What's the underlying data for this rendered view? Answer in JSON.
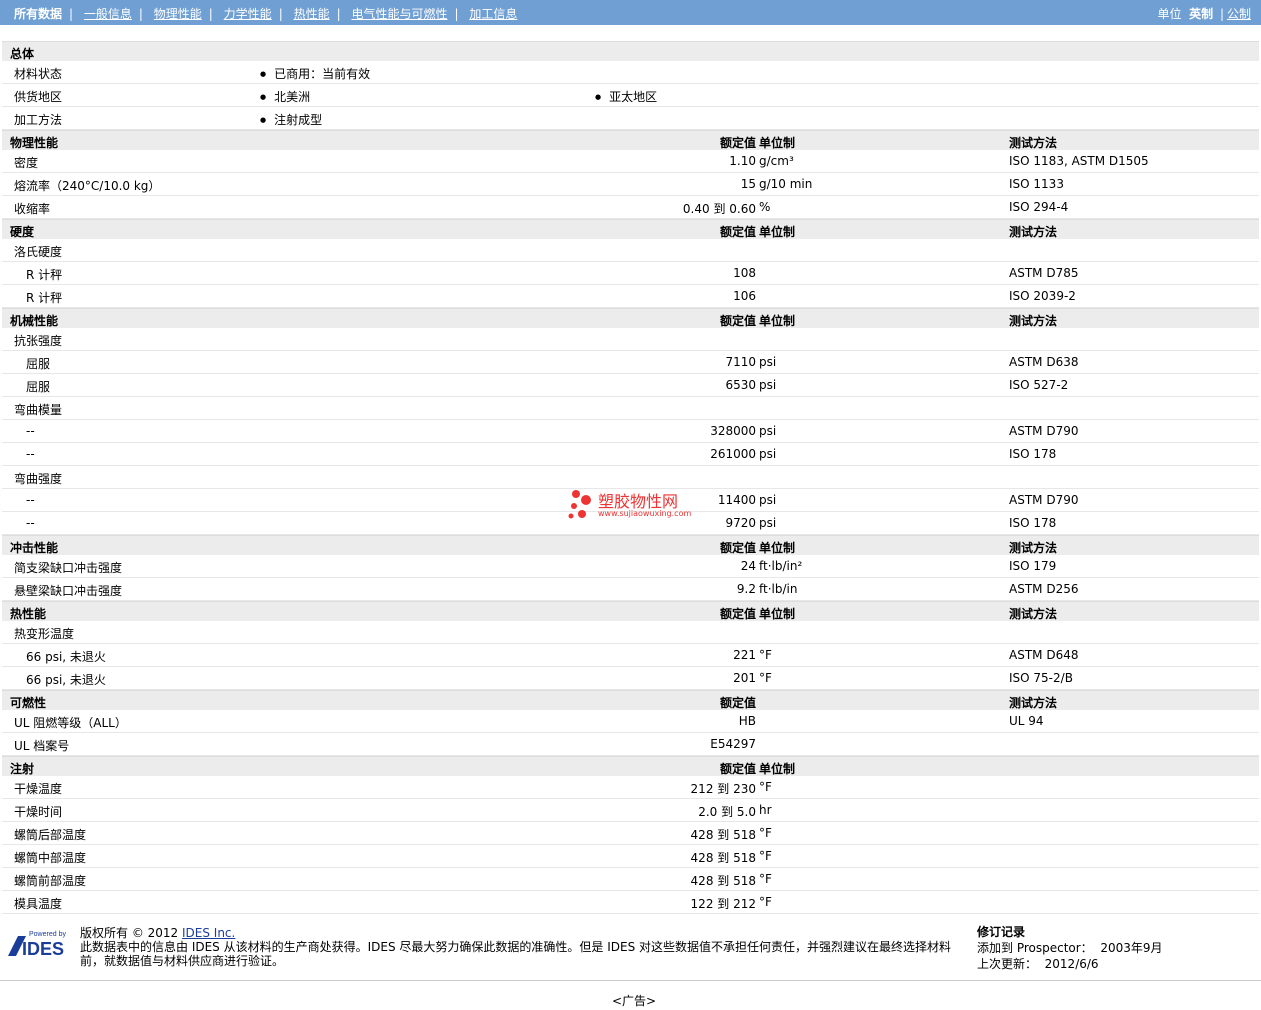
{
  "nav": {
    "items": [
      "所有数据",
      "一般信息",
      "物理性能",
      "力学性能",
      "热性能",
      "电气性能与可燃性",
      "加工信息"
    ],
    "units_label": "单位",
    "unit_selected": "英制",
    "unit_other": "公制"
  },
  "colors": {
    "topbar": "#6f9fd3",
    "section_bg": "#ececec",
    "watermark": "#e33333"
  },
  "general": {
    "title": "总体",
    "material_status": {
      "label": "材料状态",
      "values": [
        "已商用：当前有效"
      ]
    },
    "supply_region": {
      "label": "供货地区",
      "values": [
        "北美洲",
        "亚太地区"
      ]
    },
    "process": {
      "label": "加工方法",
      "values": [
        "注射成型"
      ]
    }
  },
  "headers": {
    "value": "额定值",
    "unit": "单位制",
    "method": "测试方法"
  },
  "physical": {
    "title": "物理性能",
    "rows": [
      {
        "label": "密度",
        "value": "1.10",
        "unit": "g/cm³",
        "method": "ISO 1183, ASTM D1505"
      },
      {
        "label": "熔流率（240°C/10.0 kg）",
        "value": "15",
        "unit": "g/10 min",
        "method": "ISO 1133"
      },
      {
        "label": "收缩率",
        "value": "0.40 到  0.60",
        "unit": "%",
        "method": "ISO 294-4"
      }
    ]
  },
  "hardness": {
    "title": "硬度",
    "group": "洛氏硬度",
    "rows": [
      {
        "label": "R 计秤",
        "value": "108",
        "unit": "",
        "method": "ASTM D785"
      },
      {
        "label": "R 计秤",
        "value": "106",
        "unit": "",
        "method": "ISO 2039-2"
      }
    ]
  },
  "mechanical": {
    "title": "机械性能",
    "groups": [
      {
        "name": "抗张强度",
        "rows": [
          {
            "label": "屈服",
            "value": "7110",
            "unit": "psi",
            "method": "ASTM D638"
          },
          {
            "label": "屈服",
            "value": "6530",
            "unit": "psi",
            "method": "ISO 527-2"
          }
        ]
      },
      {
        "name": "弯曲模量",
        "rows": [
          {
            "label": "--",
            "value": "328000",
            "unit": "psi",
            "method": "ASTM D790"
          },
          {
            "label": "--",
            "value": "261000",
            "unit": "psi",
            "method": "ISO 178"
          }
        ]
      },
      {
        "name": "弯曲强度",
        "rows": [
          {
            "label": "--",
            "value": "11400",
            "unit": "psi",
            "method": "ASTM D790"
          },
          {
            "label": "--",
            "value": "9720",
            "unit": "psi",
            "method": "ISO 178"
          }
        ]
      }
    ]
  },
  "impact": {
    "title": "冲击性能",
    "rows": [
      {
        "label": "简支梁缺口冲击强度",
        "value": "24",
        "unit": "ft·lb/in²",
        "method": "ISO 179"
      },
      {
        "label": "悬壁梁缺口冲击强度",
        "value": "9.2",
        "unit": "ft·lb/in",
        "method": "ASTM D256"
      }
    ]
  },
  "thermal": {
    "title": "热性能",
    "group": "热变形温度",
    "rows": [
      {
        "label": "66 psi, 未退火",
        "value": "221",
        "unit": "°F",
        "method": "ASTM D648"
      },
      {
        "label": "66 psi, 未退火",
        "value": "201",
        "unit": "°F",
        "method": "ISO 75-2/B"
      }
    ]
  },
  "flammability": {
    "title": "可燃性",
    "rows": [
      {
        "label": "UL 阻燃等级（ALL）",
        "value": "HB",
        "unit": "",
        "method": "UL 94"
      },
      {
        "label": "UL 档案号",
        "value": "E54297",
        "unit": "",
        "method": ""
      }
    ]
  },
  "injection": {
    "title": "注射",
    "rows": [
      {
        "label": "干燥温度",
        "value": "212 到  230",
        "unit": "°F"
      },
      {
        "label": "干燥时间",
        "value": "2.0 到  5.0",
        "unit": "hr"
      },
      {
        "label": "螺筒后部温度",
        "value": "428 到  518",
        "unit": "°F"
      },
      {
        "label": "螺筒中部温度",
        "value": "428 到  518",
        "unit": "°F"
      },
      {
        "label": "螺筒前部温度",
        "value": "428 到  518",
        "unit": "°F"
      },
      {
        "label": "模具温度",
        "value": "122 到  212",
        "unit": "°F"
      }
    ]
  },
  "footer": {
    "logo_text": "Powered by IDES",
    "copyright_prefix": "版权所有  © 2012 ",
    "company_link": "IDES Inc.",
    "disclaimer": "此数据表中的信息由  IDES 从该材料的生产商处获得。IDES 尽最大努力确保此数据的准确性。但是  IDES 对这些数据值不承担任何责任，并强烈建议在最终选择材料前，就数据值与材料供应商进行验证。",
    "revision_title": "修订记录",
    "added_label": "添加到  Prospector：",
    "added_value": "2003年9月",
    "updated_label": "上次更新：",
    "updated_value": "2012/6/6"
  },
  "ad": "<广告>",
  "watermark": {
    "text": "塑胶物性网",
    "url": "www.sujiaowuxing.com"
  }
}
